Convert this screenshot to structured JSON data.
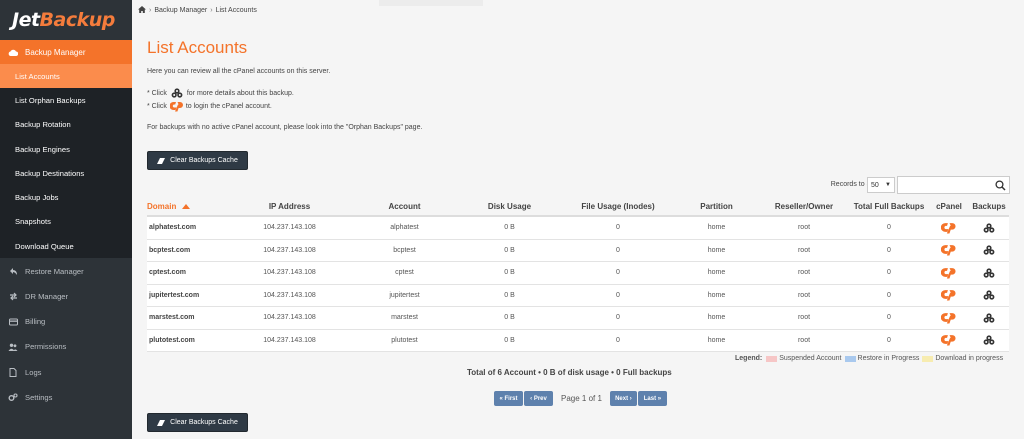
{
  "brand": {
    "part1": "Jet",
    "part2": "Backup"
  },
  "sidebar": {
    "top": {
      "label": "Backup Manager",
      "icon": "cloud-icon"
    },
    "subitems": [
      {
        "label": "List Accounts",
        "active": true
      },
      {
        "label": "List Orphan Backups"
      },
      {
        "label": "Backup Rotation"
      },
      {
        "label": "Backup Engines"
      },
      {
        "label": "Backup Destinations"
      },
      {
        "label": "Backup Jobs"
      },
      {
        "label": "Snapshots"
      },
      {
        "label": "Download Queue"
      }
    ],
    "items": [
      {
        "label": "Restore Manager",
        "icon": "undo-icon"
      },
      {
        "label": "DR Manager",
        "icon": "transfer-icon"
      },
      {
        "label": "Billing",
        "icon": "card-icon"
      },
      {
        "label": "Permissions",
        "icon": "users-icon"
      },
      {
        "label": "Logs",
        "icon": "file-icon"
      },
      {
        "label": "Settings",
        "icon": "gears-icon"
      }
    ]
  },
  "breadcrumb": {
    "section": "Backup Manager",
    "page": "List Accounts"
  },
  "page": {
    "title": "List Accounts",
    "intro": "Here you can review all the cPanel accounts on this server.",
    "hint1_pre": "* Click",
    "hint1_post": "for more details about this backup.",
    "hint2_pre": "* Click",
    "hint2_post": "to login the cPanel account.",
    "orphan_note": "For backups with no active cPanel account, please look into the \"Orphan Backups\" page.",
    "clear_cache_label": "Clear Backups Cache"
  },
  "records": {
    "label": "Records to Show:",
    "value": "50"
  },
  "table": {
    "headers": [
      "Domain",
      "IP Address",
      "Account",
      "Disk Usage",
      "File Usage (Inodes)",
      "Partition",
      "Reseller/Owner",
      "Total Full Backups",
      "cPanel",
      "Backups"
    ],
    "rows": [
      {
        "domain": "alphatest.com",
        "ip": "104.237.143.108",
        "account": "alphatest",
        "disk": "0 B",
        "files": "0",
        "partition": "home",
        "owner": "root",
        "full": "0"
      },
      {
        "domain": "bcptest.com",
        "ip": "104.237.143.108",
        "account": "bcptest",
        "disk": "0 B",
        "files": "0",
        "partition": "home",
        "owner": "root",
        "full": "0"
      },
      {
        "domain": "cptest.com",
        "ip": "104.237.143.108",
        "account": "cptest",
        "disk": "0 B",
        "files": "0",
        "partition": "home",
        "owner": "root",
        "full": "0"
      },
      {
        "domain": "jupitertest.com",
        "ip": "104.237.143.108",
        "account": "jupitertest",
        "disk": "0 B",
        "files": "0",
        "partition": "home",
        "owner": "root",
        "full": "0"
      },
      {
        "domain": "marstest.com",
        "ip": "104.237.143.108",
        "account": "marstest",
        "disk": "0 B",
        "files": "0",
        "partition": "home",
        "owner": "root",
        "full": "0"
      },
      {
        "domain": "plutotest.com",
        "ip": "104.237.143.108",
        "account": "plutotest",
        "disk": "0 B",
        "files": "0",
        "partition": "home",
        "owner": "root",
        "full": "0"
      }
    ]
  },
  "legend": {
    "label": "Legend:",
    "items": [
      {
        "label": "Suspended Account",
        "color": "#f6c6c6"
      },
      {
        "label": "Restore in Progress",
        "color": "#a9c9ee"
      },
      {
        "label": "Download in progress",
        "color": "#f7ecb0"
      }
    ]
  },
  "totals": "Total of 6 Account • 0 B of disk usage • 0 Full backups",
  "pager": {
    "first": "« First",
    "prev": "‹ Prev",
    "info": "Page 1 of 1",
    "next": "Next ›",
    "last": "Last »"
  },
  "colors": {
    "accent": "#f4732a",
    "sidebar_bg": "#2d3338",
    "button_dark": "#2f3a45",
    "pager_button": "#5e81ad"
  }
}
